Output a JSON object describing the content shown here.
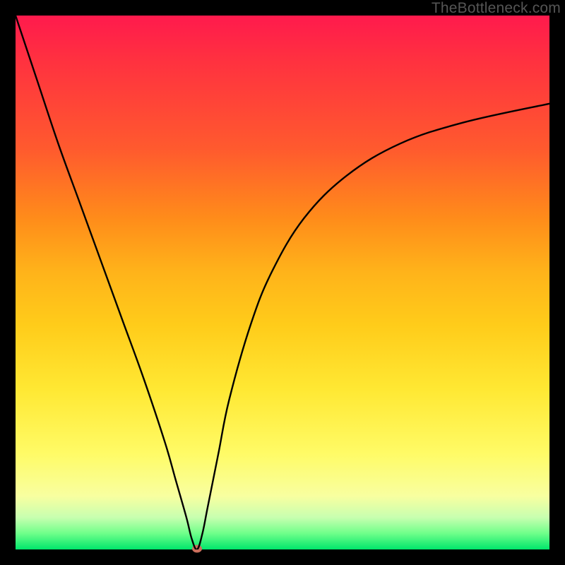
{
  "watermark": "TheBottleneck.com",
  "colors": {
    "frame": "#000000",
    "curve": "#000000",
    "dot": "#cc6e5c",
    "gradient_top": "#ff1a4d",
    "gradient_bottom": "#00e66b"
  },
  "chart_data": {
    "type": "line",
    "title": "",
    "xlabel": "",
    "ylabel": "",
    "xlim": [
      0,
      100
    ],
    "ylim": [
      0,
      100
    ],
    "grid": false,
    "legend": false,
    "annotations": [],
    "marker": {
      "x": 34,
      "y": 0
    },
    "series": [
      {
        "name": "bottleneck-curve",
        "x": [
          0,
          4,
          8,
          12,
          16,
          20,
          24,
          28,
          30,
          32,
          33,
          34,
          35,
          36,
          38,
          40,
          44,
          48,
          54,
          62,
          72,
          84,
          100
        ],
        "y": [
          100,
          88,
          76,
          65,
          54,
          43,
          32,
          20,
          13,
          6,
          2,
          0,
          3,
          8,
          18,
          28,
          42,
          52,
          62,
          70,
          76,
          80,
          83.5
        ]
      }
    ]
  }
}
